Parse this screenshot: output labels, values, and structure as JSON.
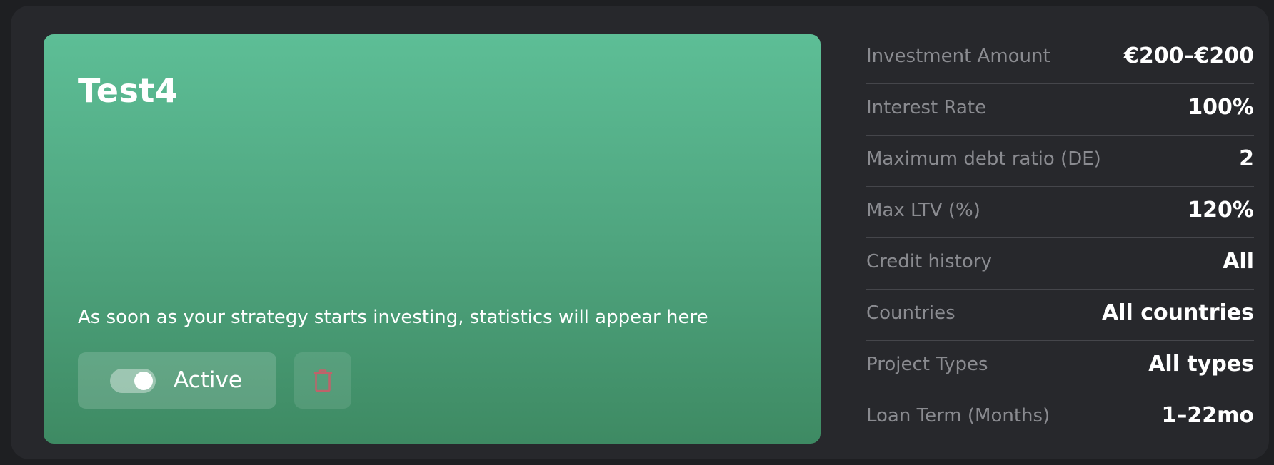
{
  "strategy": {
    "name": "Test4",
    "empty_message": "As soon as your strategy starts investing, statistics will appear here",
    "status_label": "Active",
    "status_on": true,
    "delete_icon": "trash-icon",
    "colors": {
      "card_gradient_top": "#5dbe96",
      "card_gradient_bottom": "#3e8a63",
      "delete_icon": "#c0626a",
      "panel_background": "#27282c"
    }
  },
  "details": [
    {
      "label": "Investment Amount",
      "value": "€200–€200"
    },
    {
      "label": "Interest Rate",
      "value": "100%"
    },
    {
      "label": "Maximum debt ratio (DE)",
      "value": "2"
    },
    {
      "label": "Max LTV (%)",
      "value": "120%"
    },
    {
      "label": "Credit history",
      "value": "All"
    },
    {
      "label": "Countries",
      "value": "All countries"
    },
    {
      "label": "Project Types",
      "value": "All types"
    },
    {
      "label": "Loan Term (Months)",
      "value": "1–22mo"
    }
  ]
}
